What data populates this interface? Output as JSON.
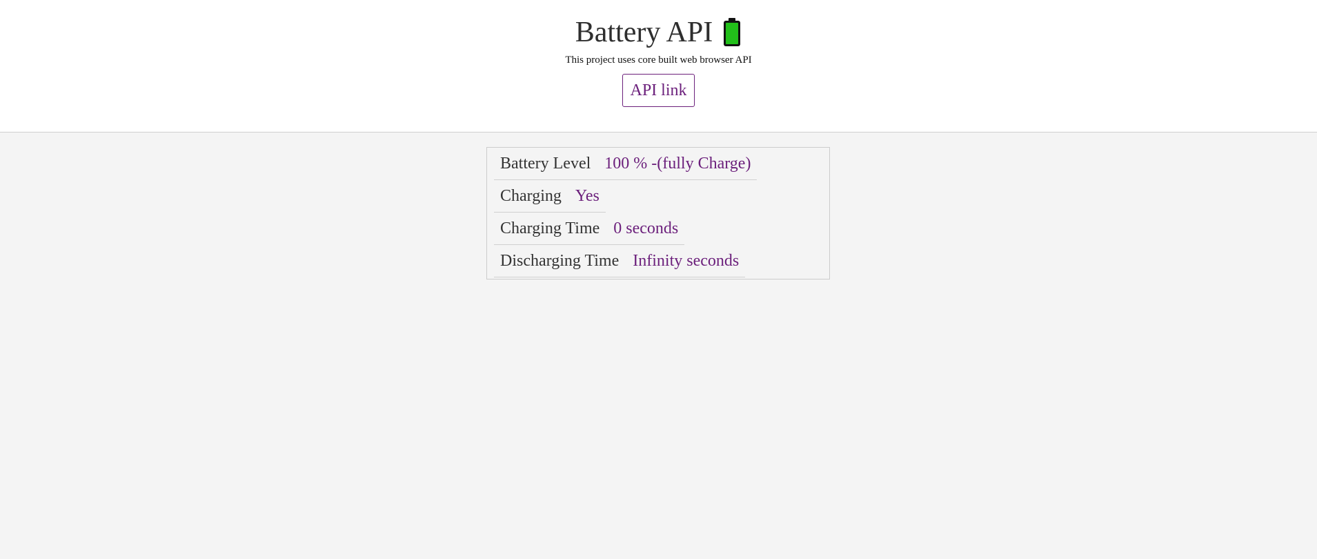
{
  "header": {
    "title": "Battery API",
    "battery_icon": "battery-icon",
    "subtitle": "This project uses core built web browser API",
    "link_label": "API link"
  },
  "colors": {
    "accent": "#6b1f7b",
    "battery_fill": "#22c01a",
    "background": "#f4f4f4"
  },
  "stats": [
    {
      "label": "Battery Level",
      "value": "100 % -(fully Charge)"
    },
    {
      "label": "Charging",
      "value": "Yes"
    },
    {
      "label": "Charging Time",
      "value": "0 seconds"
    },
    {
      "label": "Discharging Time",
      "value": "Infinity seconds"
    }
  ]
}
